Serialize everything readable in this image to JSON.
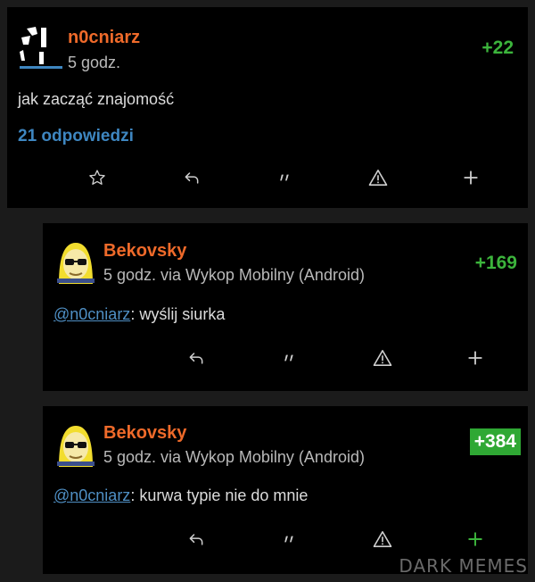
{
  "post": {
    "author": "n0cniarz",
    "time": "5 godz.",
    "score": "+22",
    "body": "jak zacząć znajomość",
    "replies_link": "21 odpowiedzi",
    "actions": [
      "star-icon",
      "reply-icon",
      "quote-icon",
      "warning-icon",
      "plus-icon"
    ]
  },
  "comments": [
    {
      "author": "Bekovsky",
      "meta": "5 godz. via Wykop Mobilny (Android)",
      "score": "+169",
      "mention": "@n0cniarz",
      "text": ": wyślij siurka",
      "actions": [
        "reply-icon",
        "quote-icon",
        "warning-icon",
        "plus-icon"
      ]
    },
    {
      "author": "Bekovsky",
      "meta": "5 godz. via Wykop Mobilny (Android)",
      "score": "+384",
      "mention": "@n0cniarz",
      "text": ": kurwa typie nie do mnie",
      "actions": [
        "reply-icon",
        "quote-icon",
        "warning-icon",
        "plus-icon"
      ]
    }
  ],
  "colors": {
    "author": "#ef6a2a",
    "score": "#3cb43c",
    "score_highlight_bg": "#2fa834",
    "link": "#3e86c0",
    "card_bg": "#000000",
    "page_bg": "#1b1b1b"
  },
  "watermark": "DARK MEMES"
}
